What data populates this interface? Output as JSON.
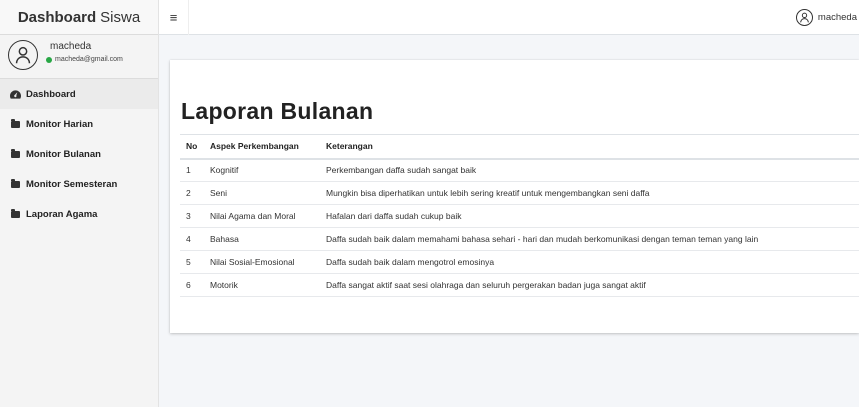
{
  "brand": {
    "bold": "Dashboard",
    "rest": "Siswa"
  },
  "user": {
    "name": "macheda",
    "email": "macheda@gmail.com"
  },
  "sidebar": {
    "items": [
      {
        "label": "Dashboard"
      },
      {
        "label": "Monitor Harian"
      },
      {
        "label": "Monitor Bulanan"
      },
      {
        "label": "Monitor Semesteran"
      },
      {
        "label": "Laporan Agama"
      }
    ]
  },
  "topbar": {
    "menu_icon": "≡",
    "username": "macheda"
  },
  "main": {
    "title": "Laporan Bulanan",
    "headers": [
      "No",
      "Aspek Perkembangan",
      "Keterangan"
    ],
    "rows": [
      [
        "1",
        "Kognitif",
        "Perkembangan daffa sudah sangat baik"
      ],
      [
        "2",
        "Seni",
        "Mungkin bisa diperhatikan untuk lebih sering kreatif untuk mengembangkan seni daffa"
      ],
      [
        "3",
        "Nilai Agama dan Moral",
        "Hafalan dari daffa sudah cukup baik"
      ],
      [
        "4",
        "Bahasa",
        "Daffa sudah baik dalam memahami bahasa sehari - hari dan mudah berkomunikasi dengan teman teman yang lain"
      ],
      [
        "5",
        "Nilai Sosial-Emosional",
        "Daffa sudah baik dalam mengotrol emosinya"
      ],
      [
        "6",
        "Motorik",
        "Daffa sangat aktif saat sesi olahraga dan seluruh pergerakan badan juga sangat aktif"
      ]
    ]
  },
  "icons": {
    "avatar": "user-outline-icon",
    "dashboard": "gauge-icon",
    "folder": "folder-icon",
    "status": "online-dot-icon"
  },
  "colors": {
    "online": "#28a745"
  }
}
